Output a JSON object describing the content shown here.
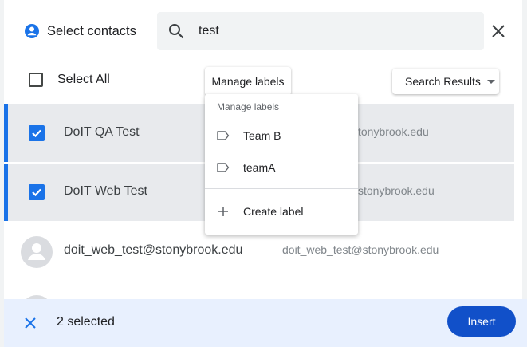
{
  "dialog": {
    "title": "Select contacts"
  },
  "search": {
    "value": "test"
  },
  "toolbar": {
    "select_all_label": "Select All",
    "manage_labels_label": "Manage labels",
    "results_dropdown_label": "Search Results"
  },
  "labels_menu": {
    "header": "Manage labels",
    "items": [
      {
        "label": "Team B",
        "icon": "label-outline-icon"
      },
      {
        "label": "teamA",
        "icon": "label-outline-icon"
      }
    ],
    "create_label": "Create label",
    "create_icon": "plus-icon"
  },
  "contacts": [
    {
      "name": "DoIT QA Test",
      "email": "tonybrook.edu",
      "selected": true
    },
    {
      "name": "DoIT Web Test",
      "email": "stonybrook.edu",
      "selected": true
    },
    {
      "name": "doit_web_test@stonybrook.edu",
      "email": "doit_web_test@stonybrook.edu",
      "selected": false
    }
  ],
  "footer": {
    "selected_count": "2 selected",
    "insert_label": "Insert"
  },
  "colors": {
    "accent": "#1a73e8",
    "insert": "#1150c9",
    "footer_bg": "#e8f0fe",
    "selected_row": "#e8eaed"
  }
}
